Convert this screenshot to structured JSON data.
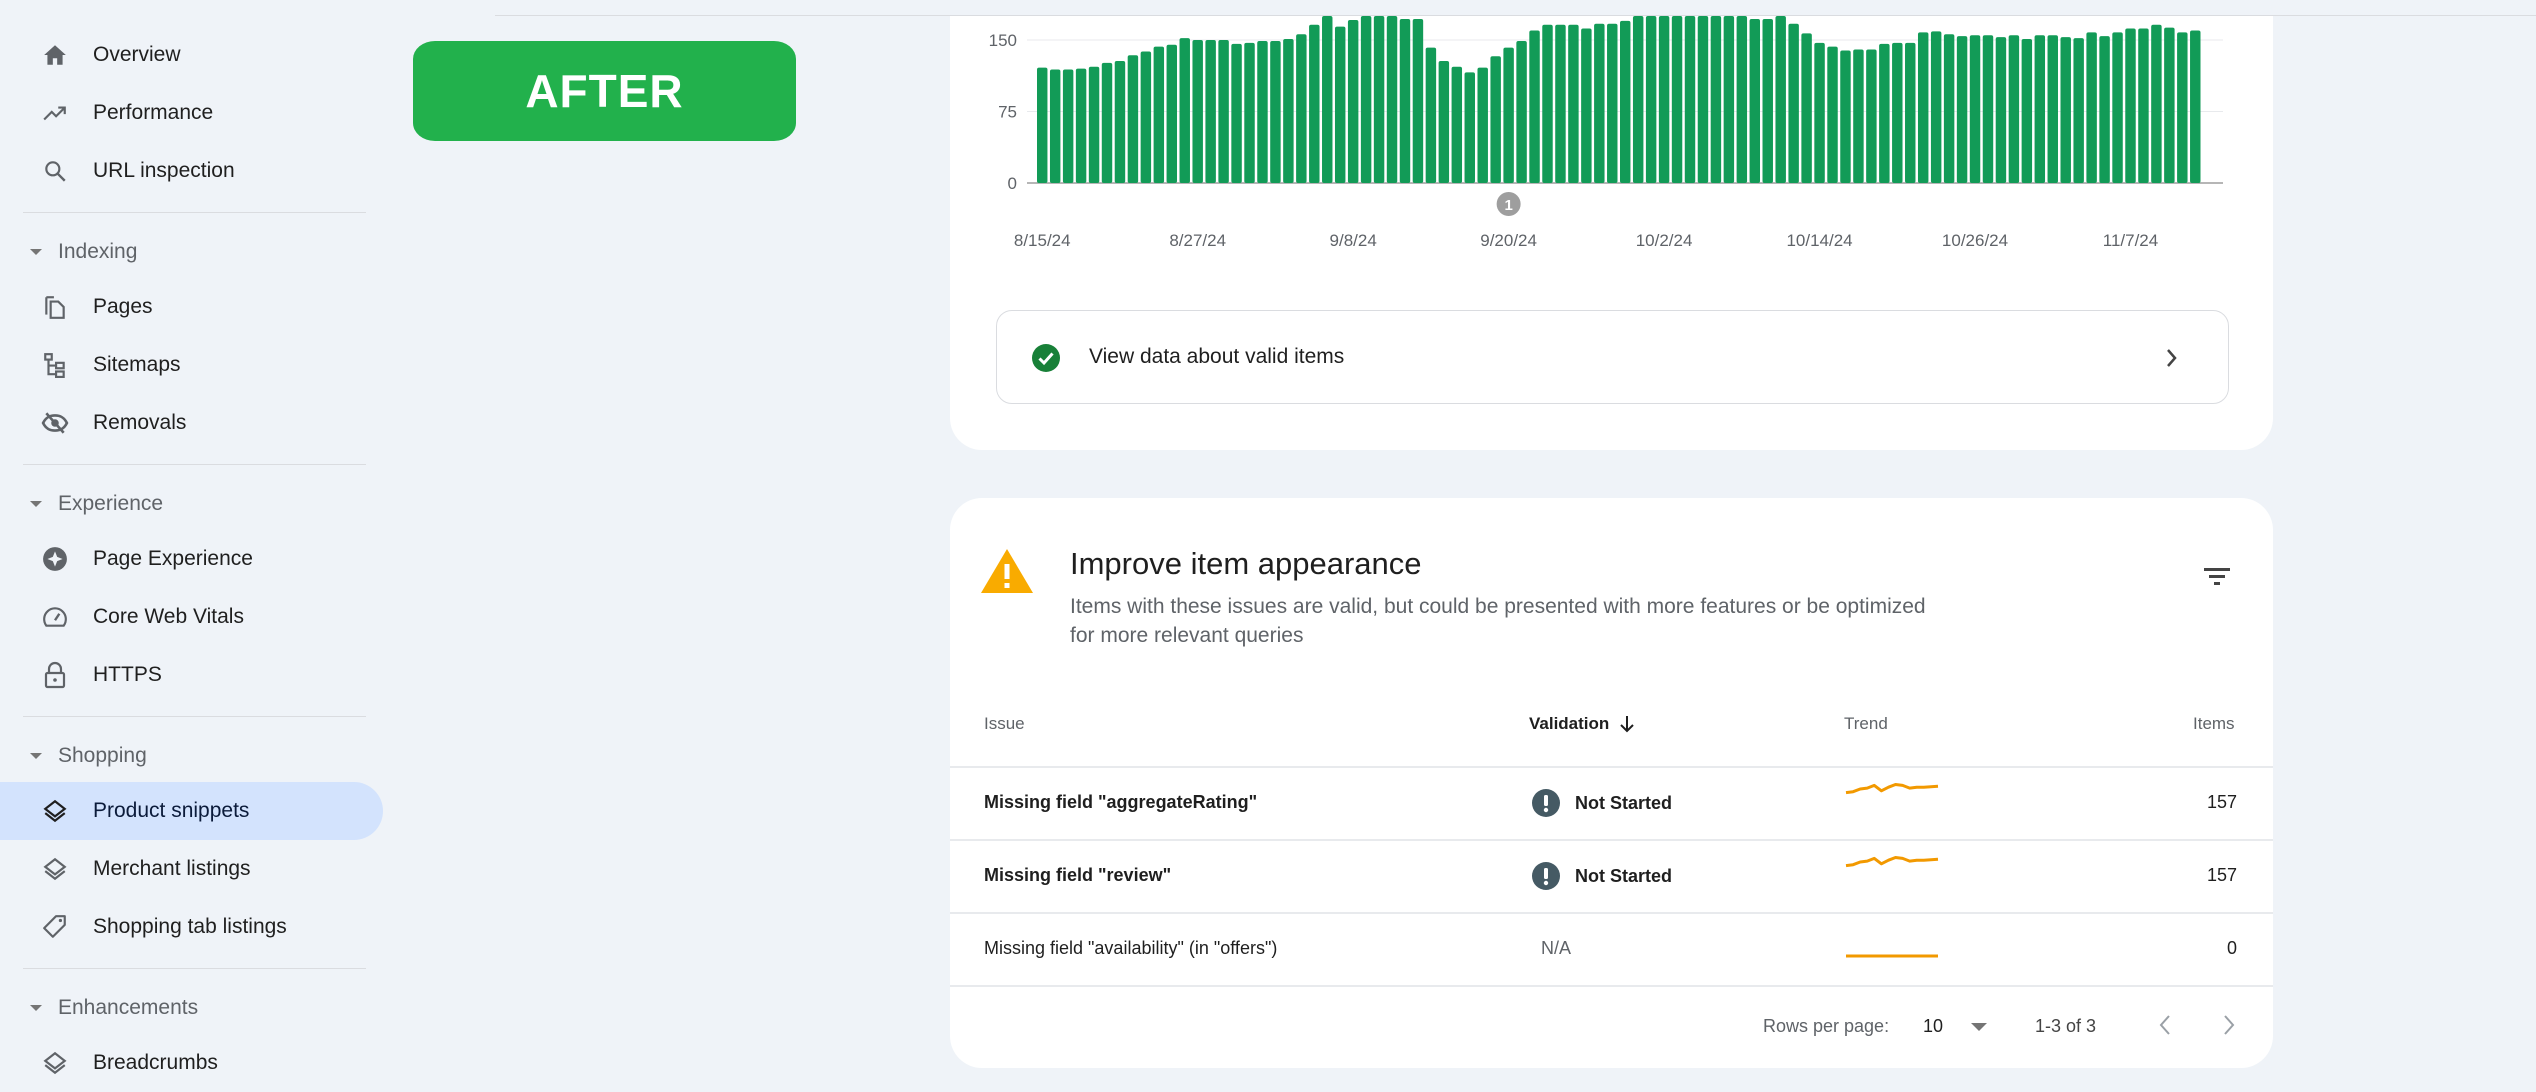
{
  "overlay_badge": {
    "label": "AFTER",
    "color": "#22b14c"
  },
  "sidebar": {
    "items": [
      {
        "type": "item",
        "label": "Overview",
        "icon": "home-icon"
      },
      {
        "type": "item",
        "label": "Performance",
        "icon": "trending-up-icon"
      },
      {
        "type": "item",
        "label": "URL inspection",
        "icon": "search-icon"
      },
      {
        "type": "section",
        "label": "Indexing"
      },
      {
        "type": "item",
        "label": "Pages",
        "icon": "pages-icon"
      },
      {
        "type": "item",
        "label": "Sitemaps",
        "icon": "sitemap-icon"
      },
      {
        "type": "item",
        "label": "Removals",
        "icon": "eye-off-icon"
      },
      {
        "type": "section",
        "label": "Experience"
      },
      {
        "type": "item",
        "label": "Page Experience",
        "icon": "sparkle-circle-icon"
      },
      {
        "type": "item",
        "label": "Core Web Vitals",
        "icon": "speedometer-icon"
      },
      {
        "type": "item",
        "label": "HTTPS",
        "icon": "lock-icon"
      },
      {
        "type": "section",
        "label": "Shopping"
      },
      {
        "type": "item",
        "label": "Product snippets",
        "icon": "layers-icon",
        "active": true
      },
      {
        "type": "item",
        "label": "Merchant listings",
        "icon": "layers-icon"
      },
      {
        "type": "item",
        "label": "Shopping tab listings",
        "icon": "tag-icon"
      },
      {
        "type": "section",
        "label": "Enhancements"
      },
      {
        "type": "item",
        "label": "Breadcrumbs",
        "icon": "layers-icon"
      }
    ]
  },
  "chart_data": {
    "type": "bar",
    "title": "",
    "xlabel": "",
    "ylabel": "",
    "ylim": [
      0,
      190
    ],
    "yticks": [
      0,
      75,
      150
    ],
    "grid": true,
    "color": "#129b57",
    "x_tick_labels": [
      "8/15/24",
      "8/27/24",
      "9/8/24",
      "9/20/24",
      "10/2/24",
      "10/14/24",
      "10/26/24",
      "11/7/24"
    ],
    "x_tick_indices": [
      0,
      12,
      24,
      36,
      48,
      60,
      72,
      84
    ],
    "annotation": {
      "label": "1",
      "index": 36
    },
    "values": [
      121,
      119,
      119,
      120,
      122,
      126,
      128,
      134,
      138,
      143,
      145,
      152,
      150,
      150,
      150,
      146,
      147,
      149,
      149,
      151,
      156,
      166,
      176,
      164,
      171,
      178,
      178,
      178,
      172,
      172,
      142,
      128,
      122,
      116,
      121,
      133,
      142,
      149,
      160,
      166,
      166,
      166,
      162,
      167,
      167,
      170,
      178,
      178,
      178,
      178,
      178,
      178,
      178,
      178,
      178,
      172,
      172,
      176,
      167,
      157,
      147,
      143,
      139,
      140,
      140,
      146,
      147,
      147,
      158,
      159,
      156,
      154,
      155,
      155,
      153,
      155,
      151,
      155,
      155,
      153,
      152,
      158,
      154,
      158,
      162,
      162,
      166,
      163,
      158,
      160
    ]
  },
  "valid_items": {
    "label": "View data about valid items"
  },
  "issues_section": {
    "title": "Improve item appearance",
    "description": "Items with these issues are valid, but could be presented with more features or be optimized for more relevant queries",
    "columns": {
      "issue": "Issue",
      "validation": "Validation",
      "trend": "Trend",
      "items": "Items"
    },
    "rows": [
      {
        "issue": "Missing field \"aggregateRating\"",
        "validation": "Not Started",
        "items": "157",
        "bold": true,
        "trend": [
          0.3,
          0.35,
          0.5,
          0.55,
          0.7,
          0.4,
          0.6,
          0.75,
          0.7,
          0.55,
          0.6,
          0.6,
          0.62,
          0.65
        ]
      },
      {
        "issue": "Missing field \"review\"",
        "validation": "Not Started",
        "items": "157",
        "bold": true,
        "trend": [
          0.3,
          0.35,
          0.5,
          0.55,
          0.7,
          0.4,
          0.6,
          0.75,
          0.7,
          0.55,
          0.6,
          0.6,
          0.62,
          0.65
        ]
      },
      {
        "issue": "Missing field \"availability\" (in \"offers\")",
        "validation": "N/A",
        "items": "0",
        "bold": false,
        "trend": [
          0,
          0,
          0,
          0,
          0,
          0,
          0,
          0,
          0,
          0,
          0,
          0,
          0,
          0
        ]
      }
    ],
    "pagination": {
      "rows_per_page_label": "Rows per page:",
      "rows_per_page_value": "10",
      "range": "1-3 of 3"
    },
    "trend_color": "#f29900"
  }
}
